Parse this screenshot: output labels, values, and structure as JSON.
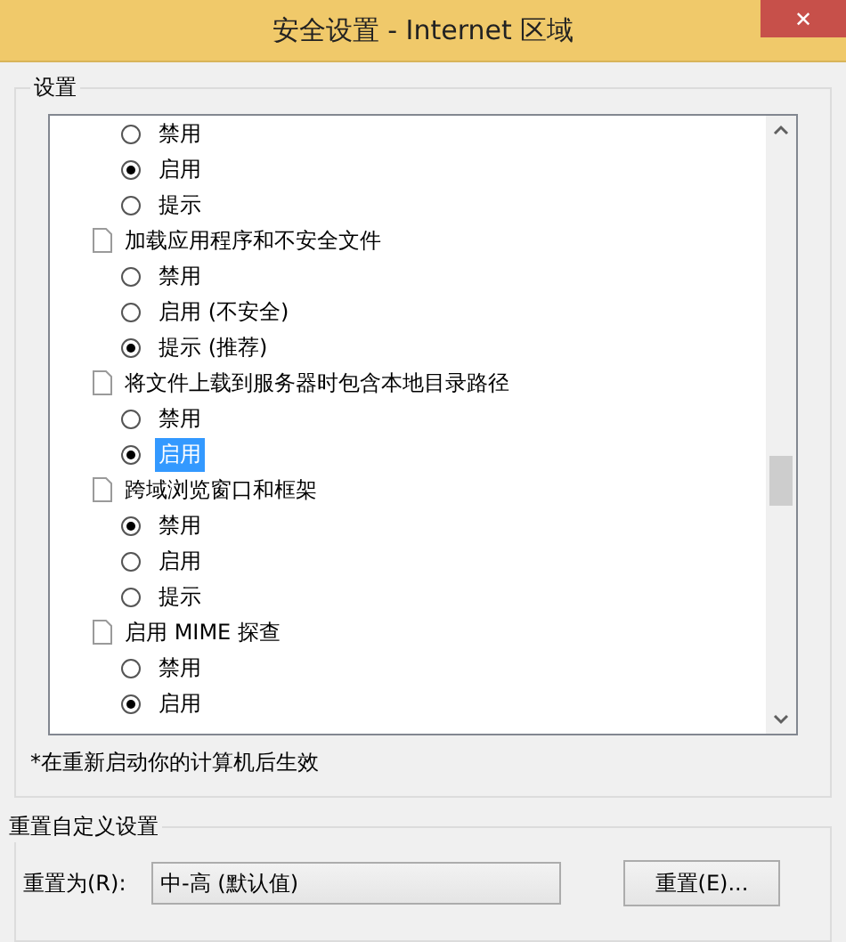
{
  "window": {
    "title": "安全设置 - Internet 区域",
    "close": "✕"
  },
  "settings": {
    "title": "设置",
    "rows": [
      {
        "kind": "option",
        "label": "禁用",
        "selected": false,
        "focused": false
      },
      {
        "kind": "option",
        "label": "启用",
        "selected": true,
        "focused": false
      },
      {
        "kind": "option",
        "label": "提示",
        "selected": false,
        "focused": false
      },
      {
        "kind": "heading",
        "label": "加载应用程序和不安全文件"
      },
      {
        "kind": "option",
        "label": "禁用",
        "selected": false,
        "focused": false
      },
      {
        "kind": "option",
        "label": "启用 (不安全)",
        "selected": false,
        "focused": false
      },
      {
        "kind": "option",
        "label": "提示 (推荐)",
        "selected": true,
        "focused": false
      },
      {
        "kind": "heading",
        "label": "将文件上载到服务器时包含本地目录路径"
      },
      {
        "kind": "option",
        "label": "禁用",
        "selected": false,
        "focused": false
      },
      {
        "kind": "option",
        "label": "启用",
        "selected": true,
        "focused": true
      },
      {
        "kind": "heading",
        "label": "跨域浏览窗口和框架"
      },
      {
        "kind": "option",
        "label": "禁用",
        "selected": true,
        "focused": false
      },
      {
        "kind": "option",
        "label": "启用",
        "selected": false,
        "focused": false
      },
      {
        "kind": "option",
        "label": "提示",
        "selected": false,
        "focused": false
      },
      {
        "kind": "heading",
        "label": "启用 MIME 探查"
      },
      {
        "kind": "option",
        "label": "禁用",
        "selected": false,
        "focused": false
      },
      {
        "kind": "option",
        "label": "启用",
        "selected": true,
        "focused": false
      }
    ],
    "note": "*在重新启动你的计算机后生效"
  },
  "reset": {
    "title": "重置自定义设置",
    "label": "重置为(R):",
    "value": "中-高 (默认值)",
    "button": "重置(E)..."
  }
}
